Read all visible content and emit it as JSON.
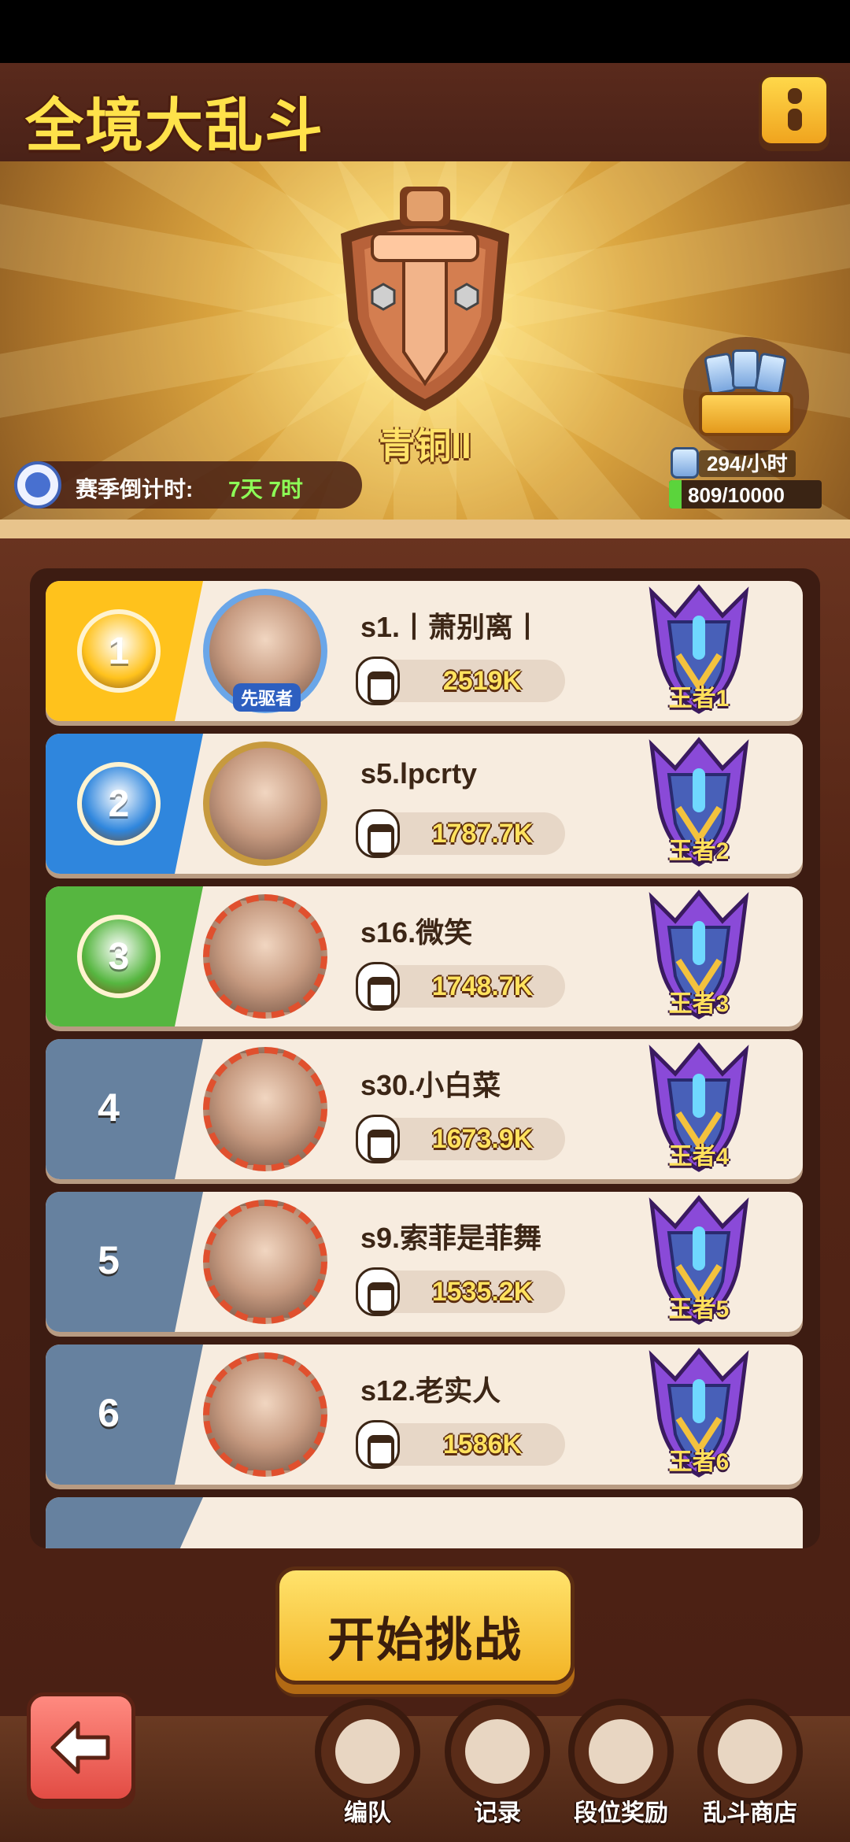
{
  "header": {
    "title": "全境大乱斗"
  },
  "season": {
    "rank_name": "青铜II",
    "countdown_label": "赛季倒计时:",
    "countdown_value": "7天 7时"
  },
  "reward": {
    "rate": "294/小时",
    "progress_text": "809/10000",
    "progress_fraction": 0.0809
  },
  "leaderboard": [
    {
      "rank": "1",
      "name": "s1.丨萧别离丨",
      "power": "2519K",
      "tier": "王者1",
      "color": "#ffc21c",
      "avatar_tag": "先驱者"
    },
    {
      "rank": "2",
      "name": "s5.lpcrty",
      "power": "1787.7K",
      "tier": "王者2",
      "color": "#2f86dd"
    },
    {
      "rank": "3",
      "name": "s16.微笑",
      "power": "1748.7K",
      "tier": "王者3",
      "color": "#56b640"
    },
    {
      "rank": "4",
      "name": "s30.小白菜",
      "power": "1673.9K",
      "tier": "王者4",
      "color": "#66819f"
    },
    {
      "rank": "5",
      "name": "s9.索菲是菲舞",
      "power": "1535.2K",
      "tier": "王者5",
      "color": "#66819f"
    },
    {
      "rank": "6",
      "name": "s12.老实人",
      "power": "1586K",
      "tier": "王者6",
      "color": "#66819f"
    }
  ],
  "actions": {
    "start": "开始挑战"
  },
  "nav": [
    {
      "label": "编队",
      "icon": "team-icon"
    },
    {
      "label": "记录",
      "icon": "record-icon"
    },
    {
      "label": "段位奖励",
      "icon": "rank-reward-icon"
    },
    {
      "label": "乱斗商店",
      "icon": "shop-icon"
    }
  ]
}
